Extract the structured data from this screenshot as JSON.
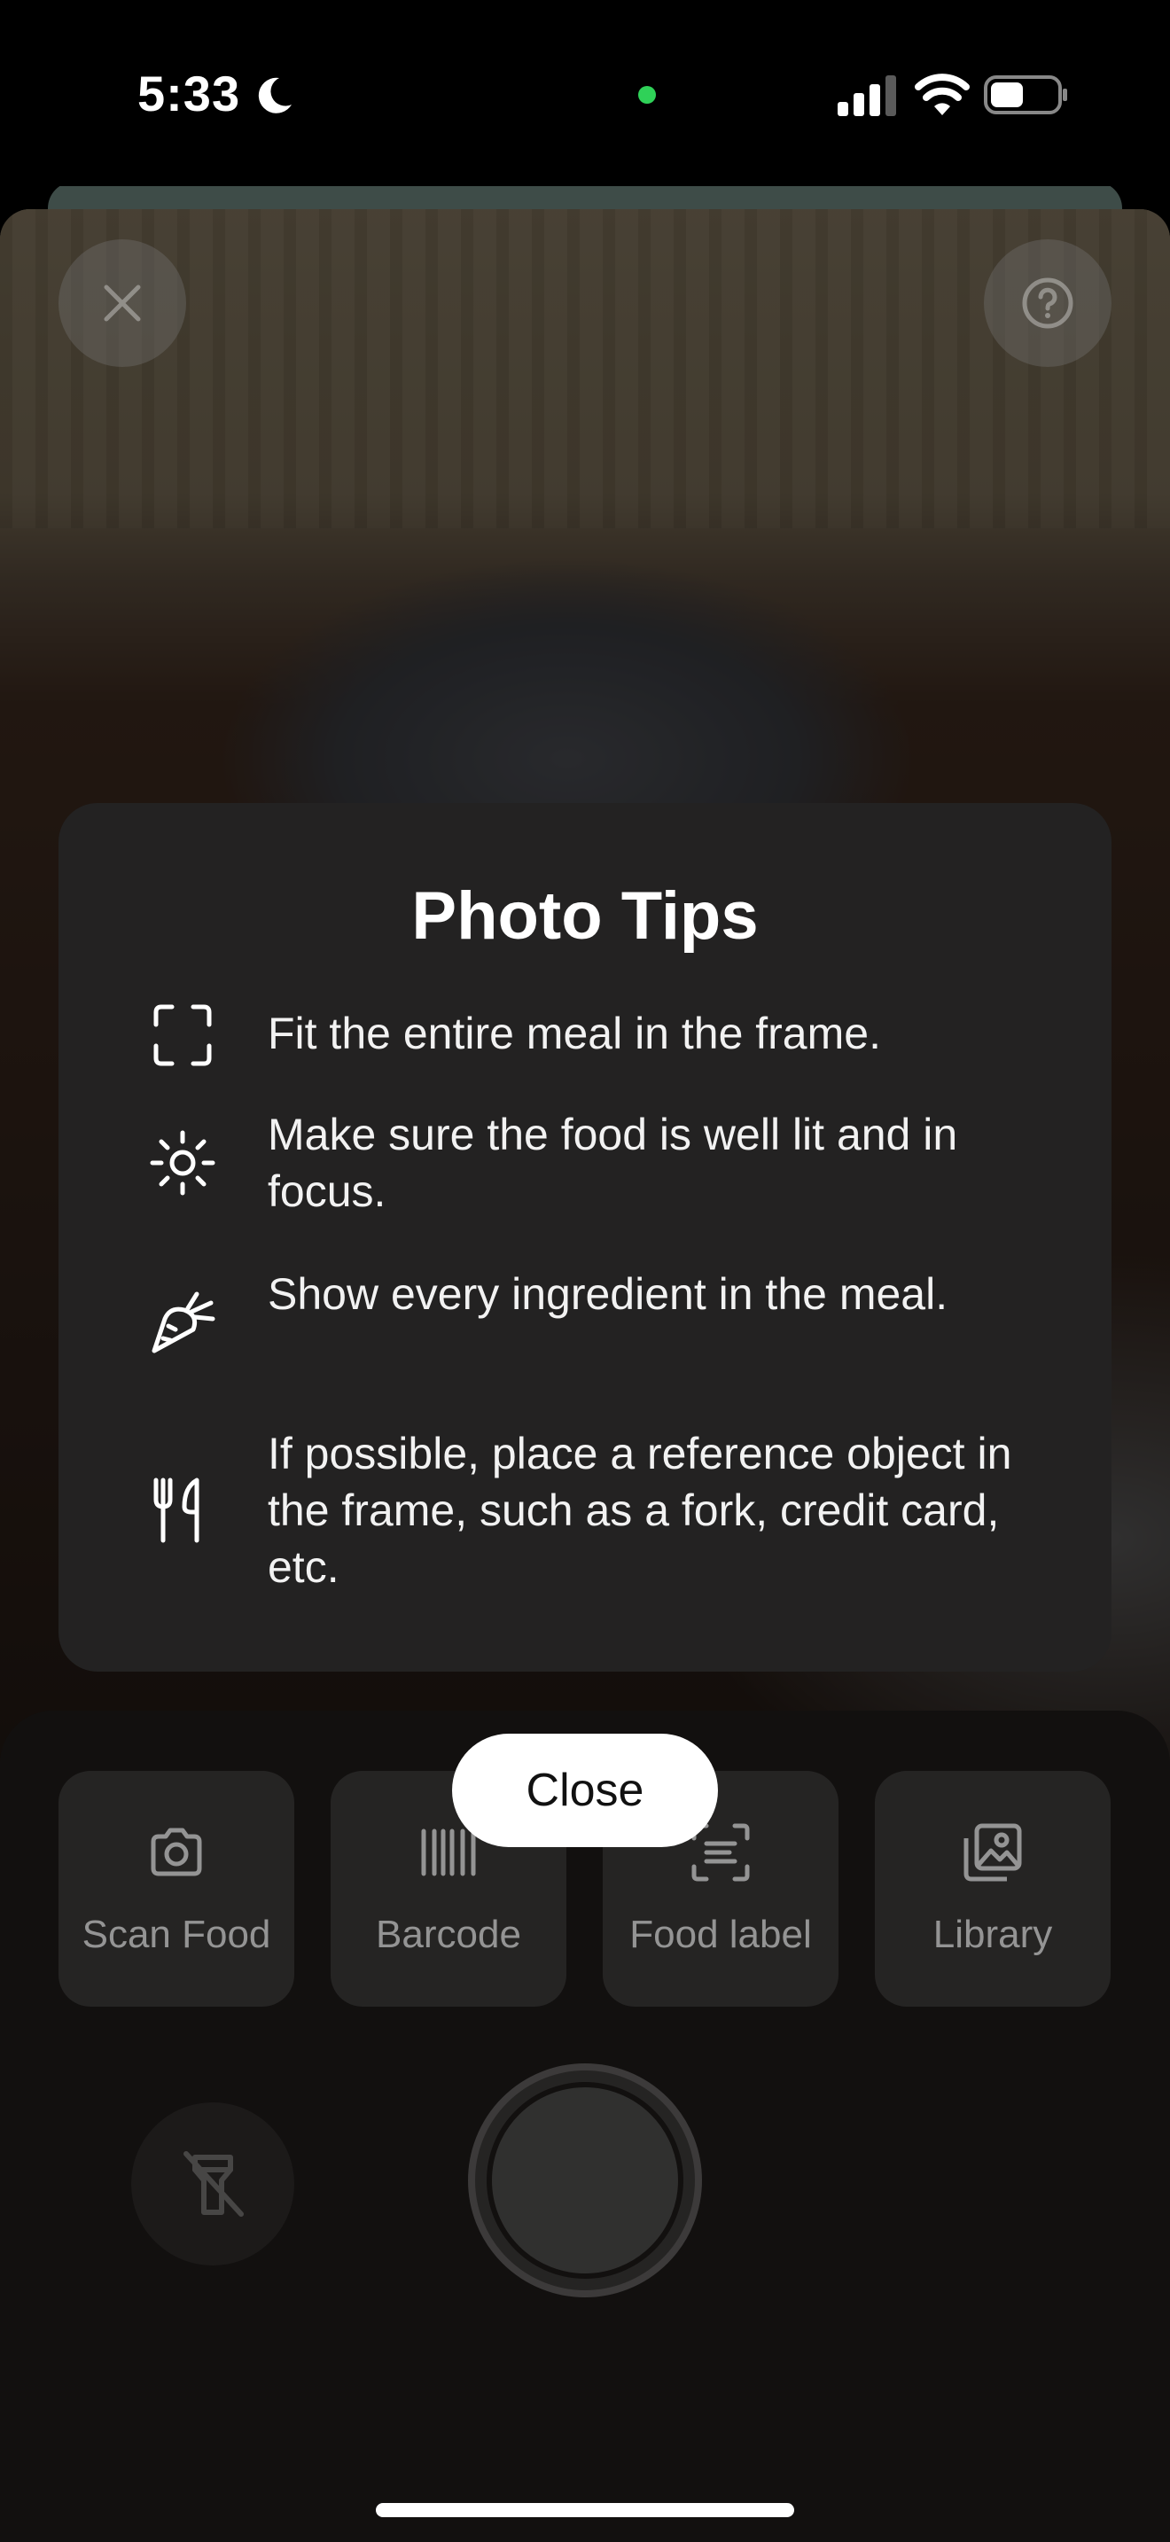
{
  "status_bar": {
    "time": "5:33",
    "focus_icon": "moon-icon",
    "camera_indicator_color": "#2fd158",
    "signal_icon": "cellular-signal-icon",
    "wifi_icon": "wifi-icon",
    "battery_icon": "battery-icon"
  },
  "camera": {
    "close_icon": "close-icon",
    "help_icon": "help-icon"
  },
  "tips": {
    "title": "Photo Tips",
    "items": [
      {
        "icon": "frame-corners-icon",
        "text": "Fit the entire meal in the frame."
      },
      {
        "icon": "sun-icon",
        "text": "Make sure the food is well lit and in focus."
      },
      {
        "icon": "carrot-icon",
        "text": "Show every ingredient in the meal."
      },
      {
        "icon": "utensils-icon",
        "text": "If possible, place a reference object in the frame, such as a fork, credit card, etc."
      }
    ],
    "close_label": "Close"
  },
  "modes": [
    {
      "icon": "camera-icon",
      "label": "Scan Food"
    },
    {
      "icon": "barcode-icon",
      "label": "Barcode"
    },
    {
      "icon": "food-label-scan-icon",
      "label": "Food label"
    },
    {
      "icon": "photo-library-icon",
      "label": "Library"
    }
  ],
  "controls": {
    "flash_icon": "flash-off-icon",
    "shutter_icon": "shutter-button"
  }
}
